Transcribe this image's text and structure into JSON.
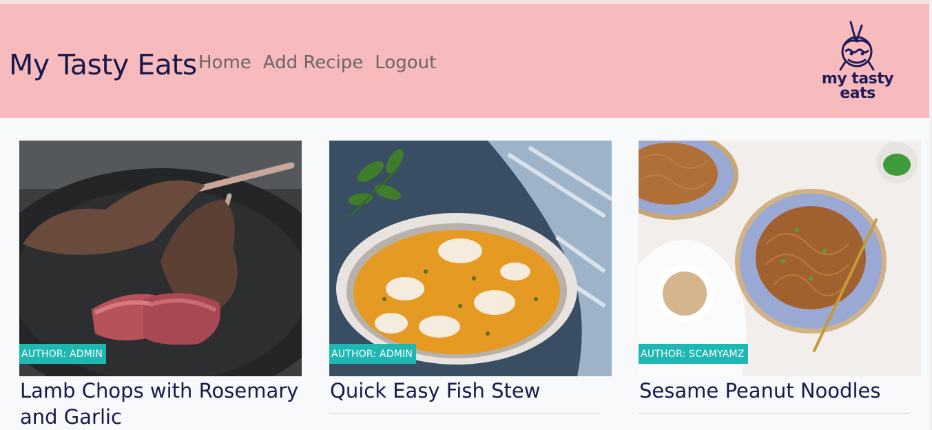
{
  "header": {
    "brand": "My Tasty Eats",
    "nav": [
      "Home",
      "Add Recipe",
      "Logout"
    ],
    "logo_text_line1": "my tasty",
    "logo_text_line2": "eats"
  },
  "recipes": [
    {
      "author": "AUTHOR: ADMIN",
      "title": "Lamb Chops with Rosemary and Garlic"
    },
    {
      "author": "AUTHOR: ADMIN",
      "title": "Quick Easy Fish Stew"
    },
    {
      "author": "AUTHOR: SCAMYAMZ",
      "title": "Sesame Peanut Noodles"
    }
  ],
  "colors": {
    "header_bg": "#f8bbbd",
    "brand": "#16194a",
    "badge": "#1fb7b2"
  }
}
